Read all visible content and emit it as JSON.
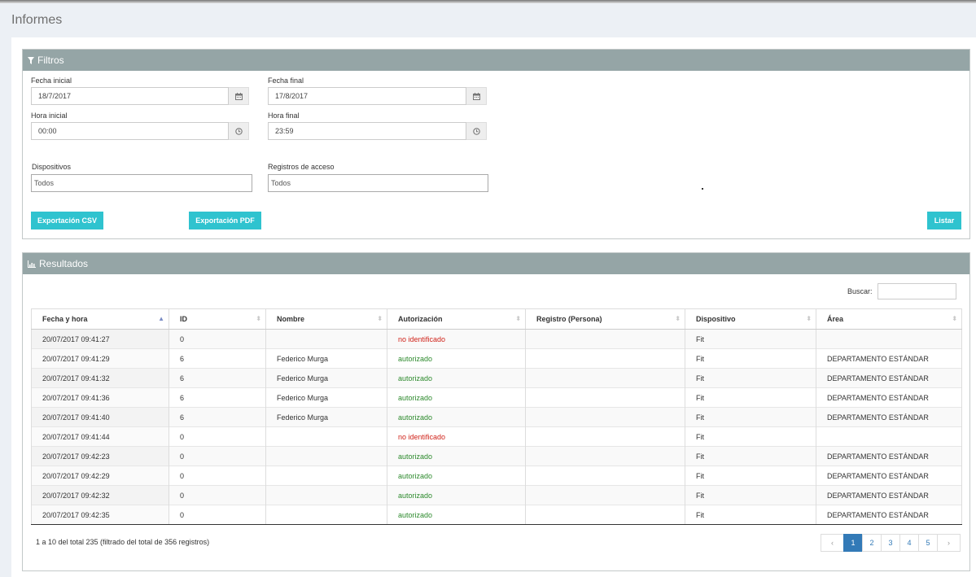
{
  "page": {
    "title": "Informes"
  },
  "filtros": {
    "heading": "Filtros",
    "fecha_inicial": {
      "label": "Fecha inicial",
      "value": "18/7/2017"
    },
    "fecha_final": {
      "label": "Fecha final",
      "value": "17/8/2017"
    },
    "hora_inicial": {
      "label": "Hora inicial",
      "value": "00:00"
    },
    "hora_final": {
      "label": "Hora final",
      "value": "23:59"
    },
    "dispositivos": {
      "label": "Dispositivos",
      "value": "Todos"
    },
    "registros": {
      "label": "Registros de acceso",
      "value": "Todos"
    },
    "buttons": {
      "csv": "Exportación CSV",
      "pdf": "Exportación PDF",
      "listar": "Listar"
    }
  },
  "resultados": {
    "heading": "Resultados",
    "search_label": "Buscar:",
    "columns": [
      "Fecha y hora",
      "ID",
      "Nombre",
      "Autorización",
      "Registro (Persona)",
      "Dispositivo",
      "Área"
    ],
    "rows": [
      [
        "20/07/2017 09:41:27",
        "0",
        "",
        "no identificado",
        "",
        "Fit",
        ""
      ],
      [
        "20/07/2017 09:41:29",
        "6",
        "Federico Murga",
        "autorizado",
        "",
        "Fit",
        "DEPARTAMENTO ESTÁNDAR"
      ],
      [
        "20/07/2017 09:41:32",
        "6",
        "Federico Murga",
        "autorizado",
        "",
        "Fit",
        "DEPARTAMENTO ESTÁNDAR"
      ],
      [
        "20/07/2017 09:41:36",
        "6",
        "Federico Murga",
        "autorizado",
        "",
        "Fit",
        "DEPARTAMENTO ESTÁNDAR"
      ],
      [
        "20/07/2017 09:41:40",
        "6",
        "Federico Murga",
        "autorizado",
        "",
        "Fit",
        "DEPARTAMENTO ESTÁNDAR"
      ],
      [
        "20/07/2017 09:41:44",
        "0",
        "",
        "no identificado",
        "",
        "Fit",
        ""
      ],
      [
        "20/07/2017 09:42:23",
        "0",
        "",
        "autorizado",
        "",
        "Fit",
        "DEPARTAMENTO ESTÁNDAR"
      ],
      [
        "20/07/2017 09:42:29",
        "0",
        "",
        "autorizado",
        "",
        "Fit",
        "DEPARTAMENTO ESTÁNDAR"
      ],
      [
        "20/07/2017 09:42:32",
        "0",
        "",
        "autorizado",
        "",
        "Fit",
        "DEPARTAMENTO ESTÁNDAR"
      ],
      [
        "20/07/2017 09:42:35",
        "0",
        "",
        "autorizado",
        "",
        "Fit",
        "DEPARTAMENTO ESTÁNDAR"
      ]
    ],
    "info": "1 a 10 del total 235 (filtrado del total de 356 registros)",
    "pagination": {
      "prev": "‹",
      "pages": [
        "1",
        "2",
        "3",
        "4",
        "5"
      ],
      "active": "1",
      "next": "›"
    }
  },
  "colors": {
    "panel_header": "#95a5a6",
    "button": "#2fc3cf",
    "authorized": "#2d8a2d",
    "unidentified": "#d0241b",
    "pagination_active": "#337ab7"
  },
  "icons": {
    "filter": "filter-icon",
    "chart": "bar-chart-icon",
    "calendar": "calendar-icon",
    "clock": "clock-icon"
  }
}
